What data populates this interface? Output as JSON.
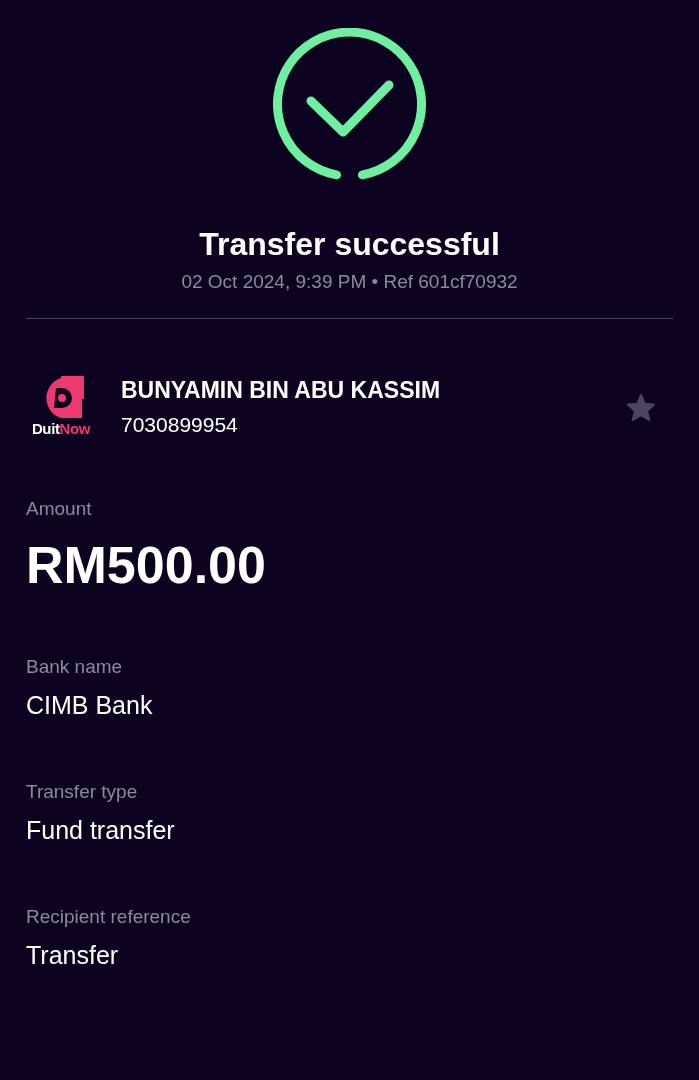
{
  "status": {
    "title": "Transfer successful",
    "meta": "02 Oct 2024, 9:39 PM • Ref 601cf70932"
  },
  "recipient": {
    "logo_parts": [
      "Duit",
      "Now"
    ],
    "name": "BUNYAMIN BIN ABU KASSIM",
    "account": "7030899954",
    "favorite": false
  },
  "amount": {
    "label": "Amount",
    "value": "RM500.00"
  },
  "details": [
    {
      "label": "Bank name",
      "value": "CIMB Bank"
    },
    {
      "label": "Transfer type",
      "value": "Fund transfer"
    },
    {
      "label": "Recipient reference",
      "value": "Transfer"
    }
  ]
}
